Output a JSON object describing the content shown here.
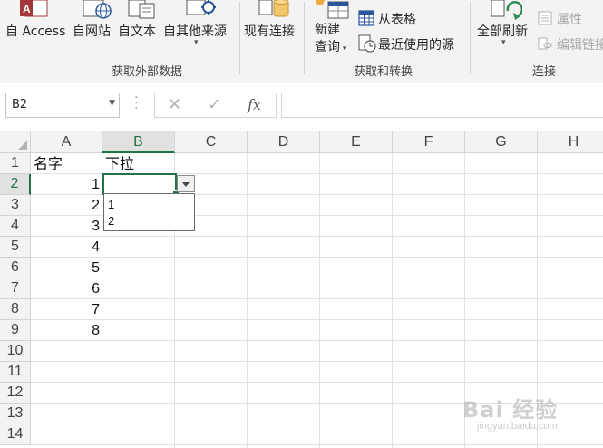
{
  "ribbon": {
    "buttons": {
      "from_access": "自 Access",
      "from_web": "自网站",
      "from_text": "自文本",
      "from_other": "自其他来源",
      "existing_connections": "现有连接",
      "new_query_line1": "新建",
      "new_query_line2": "查询",
      "from_table": "从表格",
      "recent_sources": "最近使用的源",
      "refresh_all": "全部刷新",
      "properties": "属性",
      "edit_links": "编辑链接"
    },
    "groups": {
      "get_external_data": "获取外部数据",
      "get_transform": "获取和转换",
      "connections": "连接"
    }
  },
  "formula_bar": {
    "name_box": "B2",
    "cancel_glyph": "✕",
    "enter_glyph": "✓",
    "fx_label": "fx",
    "value": ""
  },
  "grid": {
    "columns": [
      "A",
      "B",
      "C",
      "D",
      "E",
      "F",
      "G",
      "H"
    ],
    "rows": [
      "1",
      "2",
      "3",
      "4",
      "5",
      "6",
      "7",
      "8",
      "9",
      "10",
      "11",
      "12",
      "13",
      "14"
    ],
    "cells": {
      "A1": "名字",
      "B1": "下拉",
      "A2": "1",
      "A3": "2",
      "A4": "3",
      "A5": "4",
      "A6": "5",
      "A7": "6",
      "A8": "7",
      "A9": "8"
    },
    "active_cell": "B2",
    "dropdown_options": [
      "1",
      "2"
    ]
  },
  "watermark": {
    "text": "Bai 经验",
    "sub": "jingyan.baidu.com"
  },
  "colors": {
    "accent": "#217346",
    "excel_green": "#217346",
    "access_red": "#a4373a",
    "refresh_green": "#2e8b57",
    "link_blue": "#2b579a"
  }
}
